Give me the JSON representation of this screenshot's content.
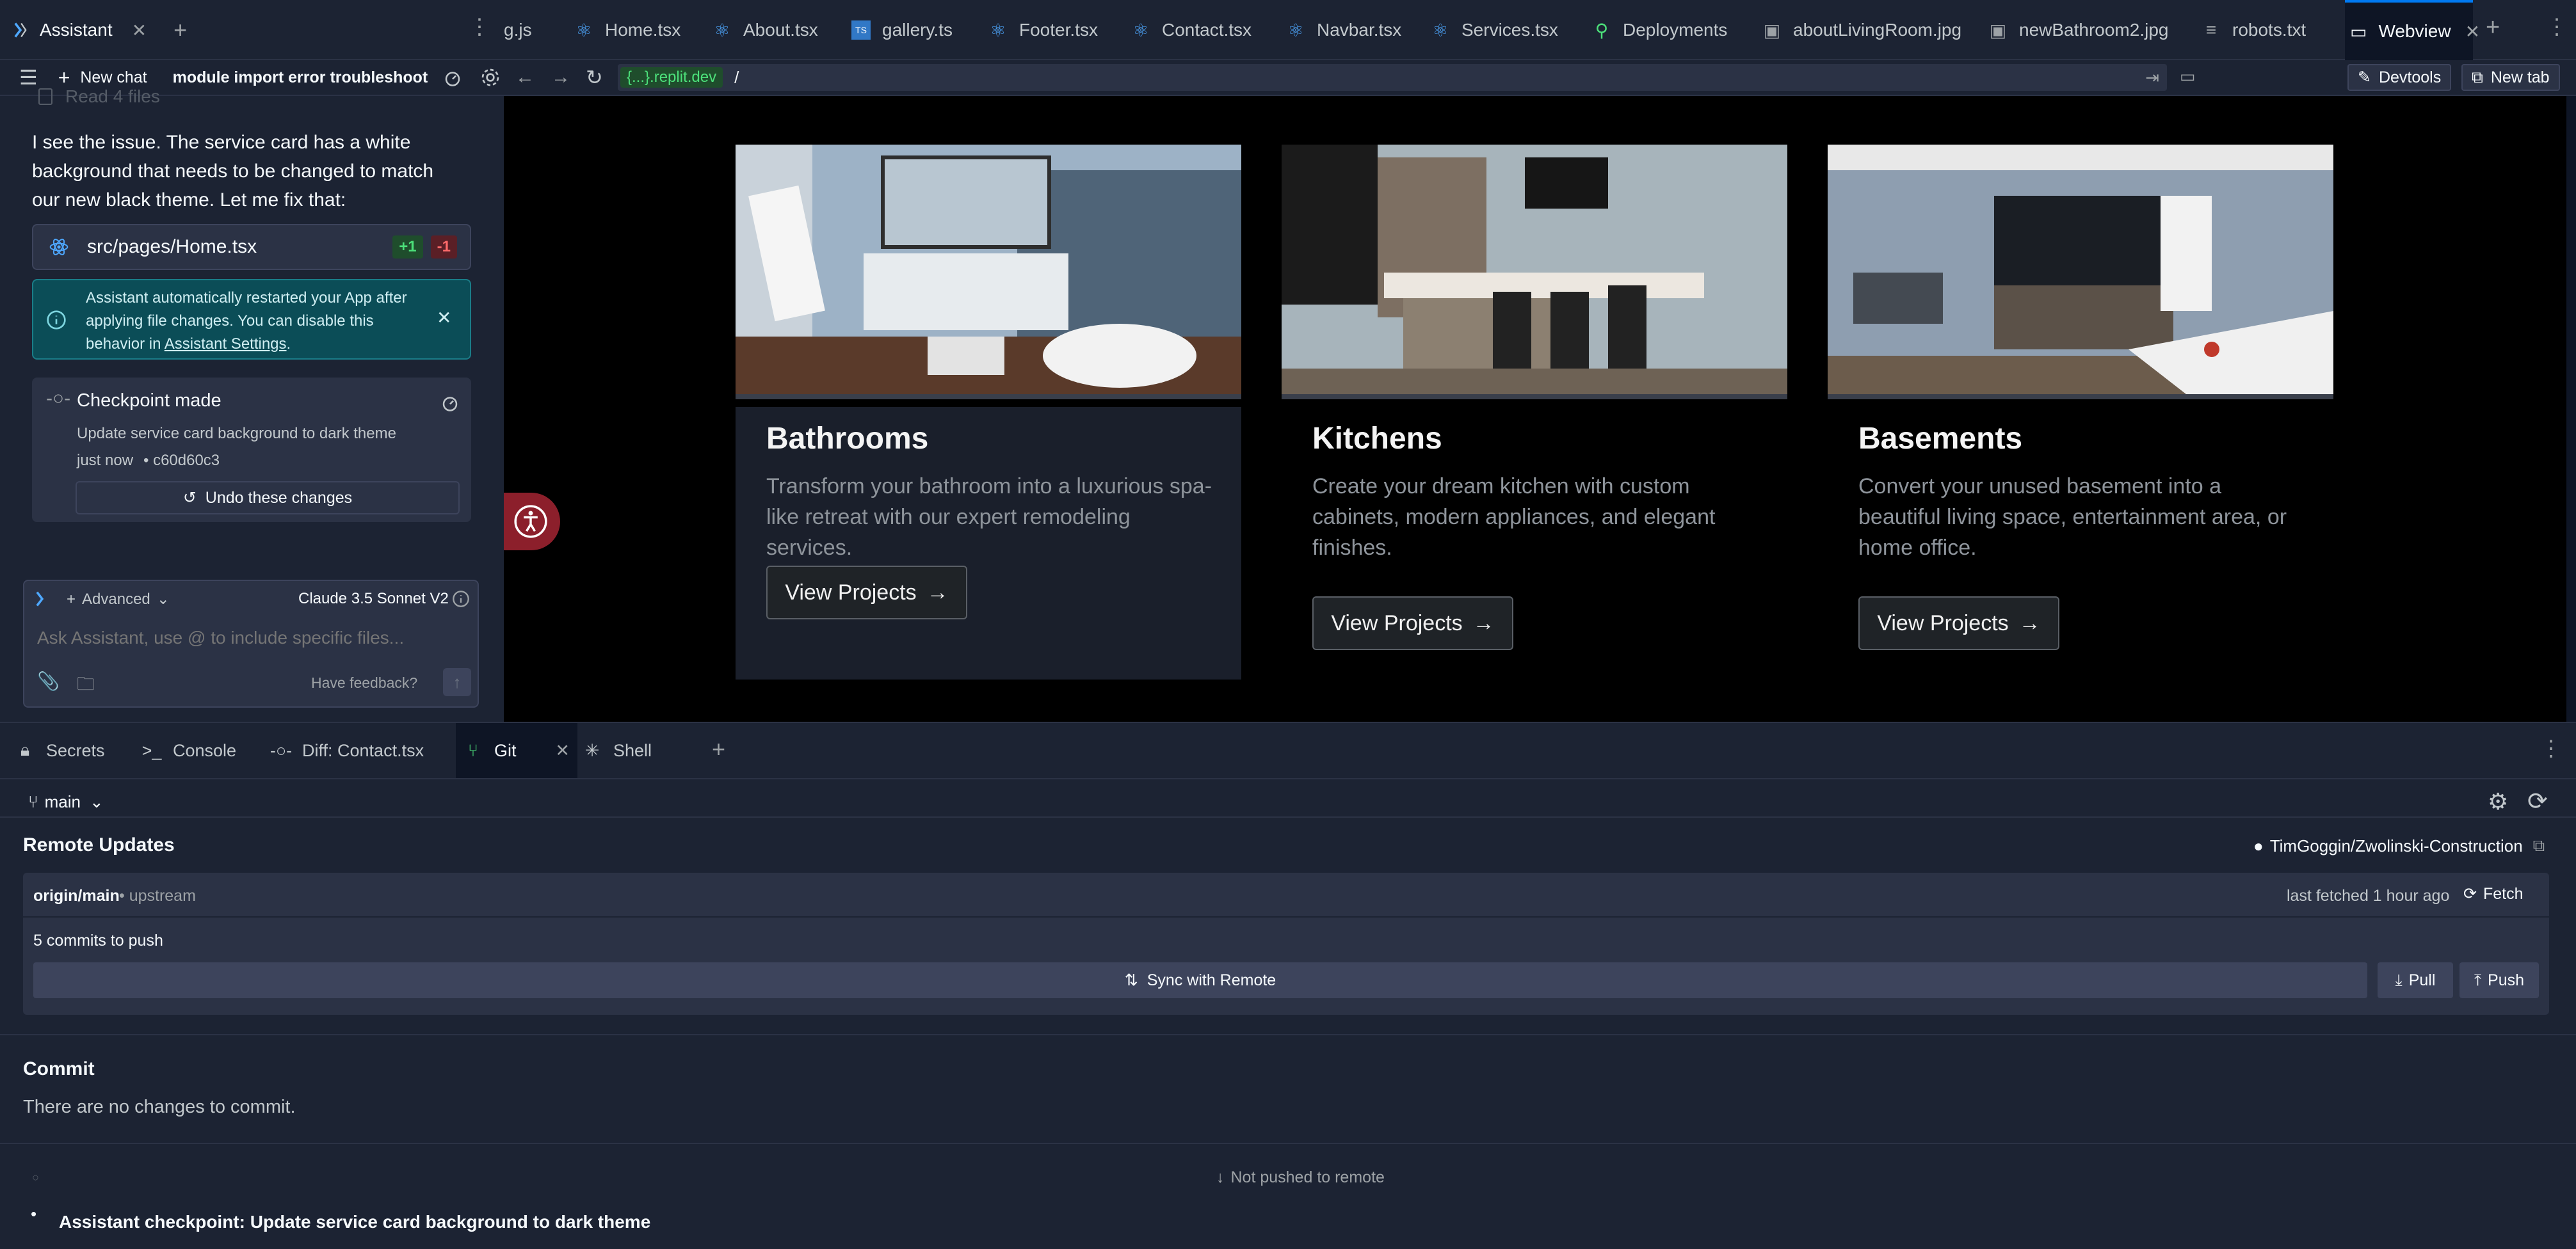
{
  "assistant": {
    "tab_title": "Assistant",
    "new_chat": "New chat",
    "chat_title": "module import error troubleshooti...",
    "read_files": "Read 4 files",
    "message": "I see the issue. The service card has a white background that needs to be changed to match our new black theme. Let me fix that:",
    "file_change": {
      "name": "src/pages/Home.tsx",
      "added": "+1",
      "removed": "-1"
    },
    "notice": {
      "text": "Assistant automatically restarted your App after applying file changes. You can disable this behavior in ",
      "link": "Assistant Settings",
      "suffix": "."
    },
    "checkpoint": {
      "title": "Checkpoint made",
      "description": "Update service card background to dark theme",
      "time": "just now",
      "hash": "• c60d60c3",
      "undo": "Undo these changes"
    },
    "composer": {
      "mode": "Advanced",
      "model": "Claude 3.5 Sonnet V2",
      "placeholder": "Ask Assistant, use @ to include specific files...",
      "feedback": "Have feedback?"
    }
  },
  "editor_tabs": [
    {
      "label": "g.js",
      "icon": "js-file-icon"
    },
    {
      "label": "Home.tsx",
      "icon": "react-icon"
    },
    {
      "label": "About.tsx",
      "icon": "react-icon"
    },
    {
      "label": "gallery.ts",
      "icon": "ts-file-icon"
    },
    {
      "label": "Footer.tsx",
      "icon": "react-icon"
    },
    {
      "label": "Contact.tsx",
      "icon": "react-icon"
    },
    {
      "label": "Navbar.tsx",
      "icon": "react-icon"
    },
    {
      "label": "Services.tsx",
      "icon": "react-icon"
    },
    {
      "label": "Deployments",
      "icon": "deploy-icon"
    },
    {
      "label": "aboutLivingRoom.jpg",
      "icon": "image-icon"
    },
    {
      "label": "newBathroom2.jpg",
      "icon": "image-icon"
    },
    {
      "label": "robots.txt",
      "icon": "text-file-icon"
    },
    {
      "label": "Webview",
      "icon": "webview-icon"
    }
  ],
  "url": {
    "domain": "{...}.replit.dev",
    "path": "/",
    "devtools": "Devtools",
    "new_tab": "New tab"
  },
  "services": [
    {
      "title": "Bathrooms",
      "description": "Transform your bathroom into a luxurious spa-like retreat with our expert remodeling services.",
      "button": "View Projects"
    },
    {
      "title": "Kitchens",
      "description": "Create your dream kitchen with custom cabinets, modern appliances, and elegant finishes.",
      "button": "View Projects"
    },
    {
      "title": "Basements",
      "description": "Convert your unused basement into a beautiful living space, entertainment area, or home office.",
      "button": "View Projects"
    }
  ],
  "bottom_tabs": [
    {
      "label": "Secrets",
      "icon": "lock-icon"
    },
    {
      "label": "Console",
      "icon": "terminal-icon"
    },
    {
      "label": "Diff: Contact.tsx",
      "icon": "diff-icon"
    },
    {
      "label": "Git",
      "icon": "git-icon"
    },
    {
      "label": "Shell",
      "icon": "shell-icon"
    }
  ],
  "git": {
    "branch": "main",
    "remote_updates": "Remote Updates",
    "repo": "TimGoggin/Zwolinski-Construction",
    "origin": "origin/main",
    "upstream": "• upstream",
    "last_fetched": "last fetched 1 hour ago",
    "fetch": "Fetch",
    "commits_to_push": "5 commits to push",
    "sync": "Sync with Remote",
    "pull": "Pull",
    "push": "Push",
    "commit_heading": "Commit",
    "no_changes": "There are no changes to commit.",
    "not_pushed": "Not pushed to remote",
    "checkpoint_commit": "Assistant checkpoint: Update service card background to dark theme"
  },
  "colors": {
    "accent": "#0079f2",
    "panel": "#1c2333",
    "green": "#4ce07a",
    "red": "#ff6b6b",
    "info_bg": "#0b4d57"
  }
}
